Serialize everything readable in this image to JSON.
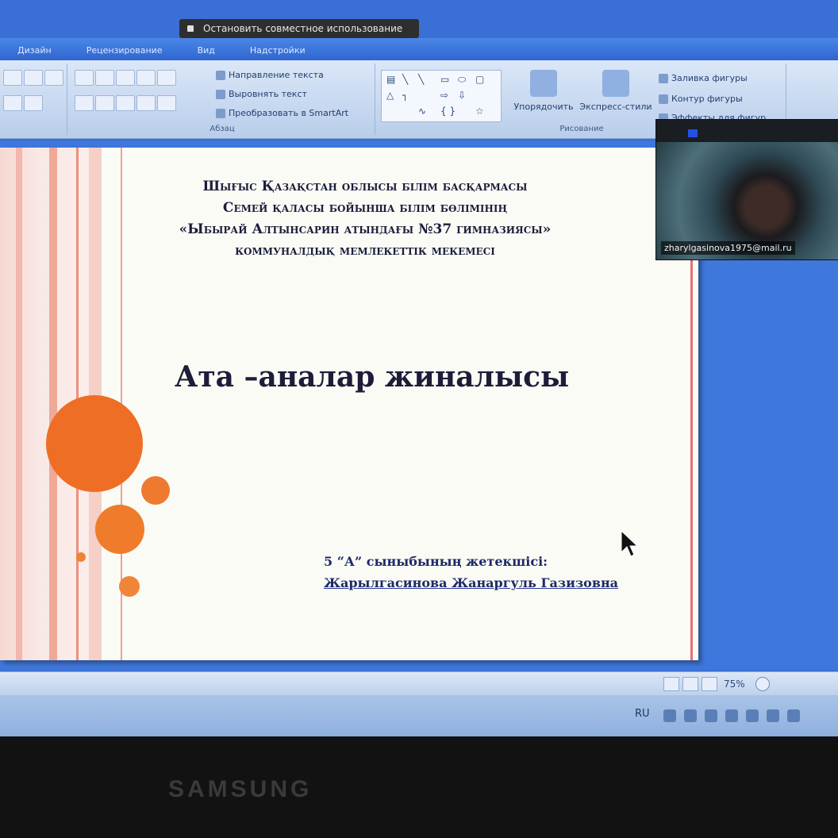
{
  "share_bar": {
    "stop_label": "Остановить совместное использование"
  },
  "ribbon_tabs": [
    "Дизайн",
    "Рецензирование",
    "Вид",
    "Надстройки"
  ],
  "ribbon": {
    "paragraph_group": {
      "label": "Абзац",
      "text_direction": "Направление текста",
      "align_text": "Выровнять текст",
      "convert_smartart": "Преобразовать в SmartArt"
    },
    "drawing_group": {
      "label": "Рисование",
      "arrange": "Упорядочить",
      "quick_styles": "Экспресс-стили",
      "shape_fill": "Заливка фигуры",
      "shape_outline": "Контур фигуры",
      "shape_effects": "Эффекты для фигур"
    }
  },
  "slide": {
    "header_lines": [
      "Шығыс Қазақстан облысы білім басқармасы",
      "Семей қаласы бойынша білім бөлімінің",
      "«Ыбырай Алтынсарин атындағы №37 гимназиясы»",
      "коммуналдық мемлекеттік мекемесі"
    ],
    "title": "Ата –аналар жиналысы",
    "author_role": "5 “А” сыныбының жетекшісі:",
    "author_name": "Жарылгасинова Жанаргуль Газизовна"
  },
  "video_overlay": {
    "participant": "zharylgasinova1975@mail.ru"
  },
  "statusbar": {
    "zoom": "75%"
  },
  "taskbar": {
    "language": "RU"
  },
  "monitor": {
    "brand": "SAMSUNG"
  },
  "colors": {
    "accent_orange": "#ef6f24",
    "ribbon_blue": "#2f66cf",
    "slide_stripe": "#f2b9b0"
  }
}
